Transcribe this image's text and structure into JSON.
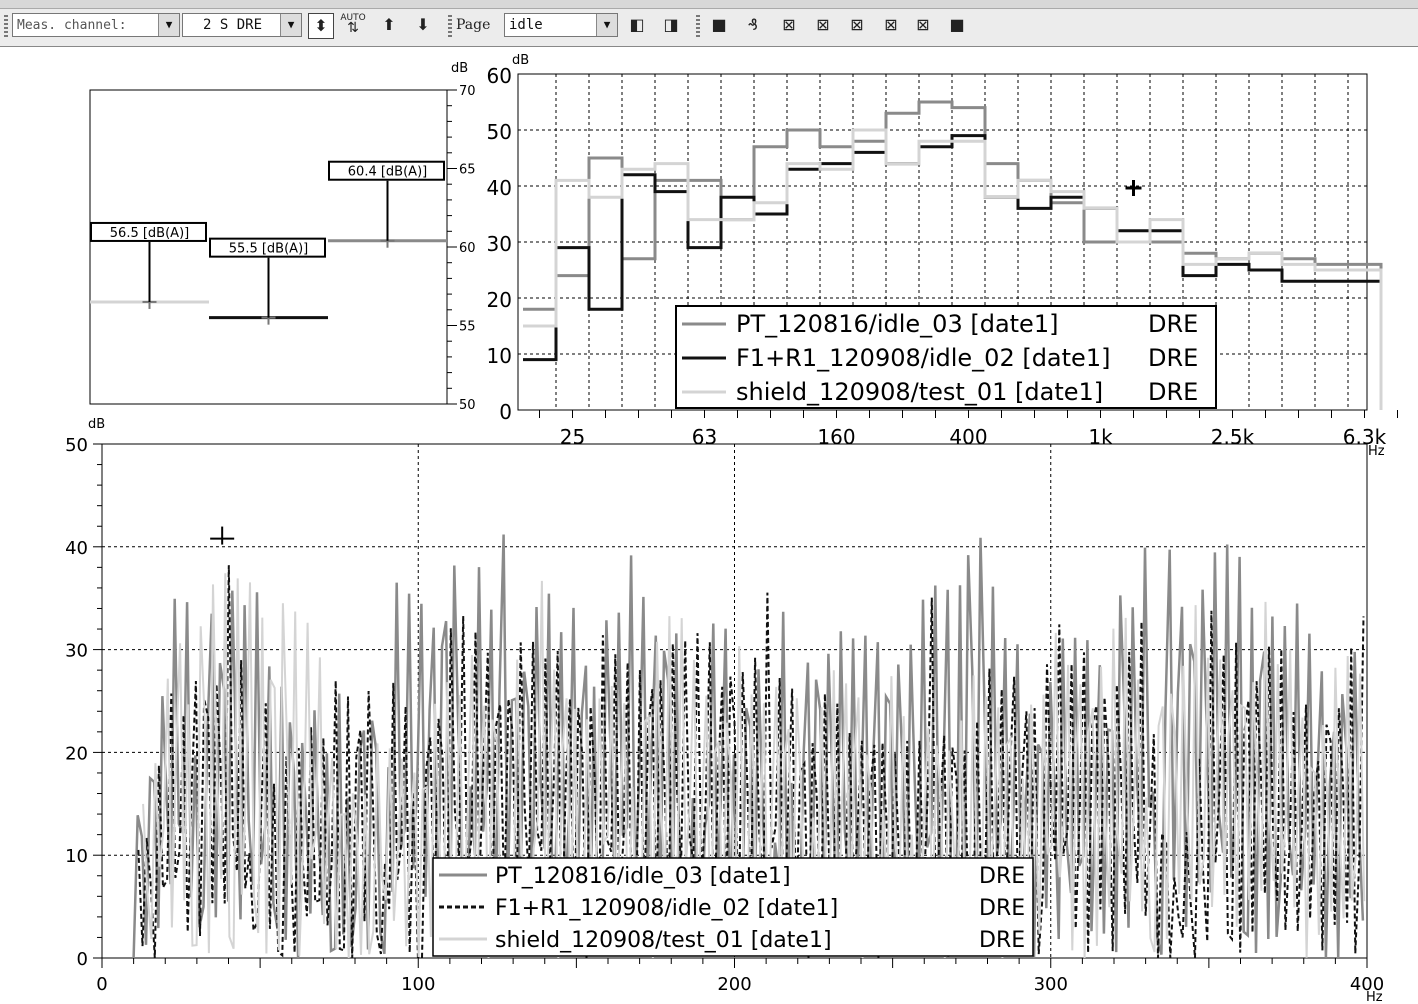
{
  "toolbar": {
    "meas_channel_label": "Meas. channel:",
    "channel_value": "2  S DRE",
    "page_label": "Page",
    "page_value": "idle",
    "auto_label": "AUTO"
  },
  "chart_data": [
    {
      "type": "bar",
      "id": "overall",
      "ylabel": "dB",
      "ylim": [
        50,
        70
      ],
      "yticks": [
        50,
        55,
        60,
        65,
        70
      ],
      "bars": [
        {
          "value": 56.5,
          "label": "56.5  [dB(A)]",
          "color": "#d4d4d4"
        },
        {
          "value": 55.5,
          "label": "55.5  [dB(A)]",
          "color": "#111111"
        },
        {
          "value": 60.4,
          "label": "60.4  [dB(A)]",
          "color": "#8a8a8a"
        }
      ]
    },
    {
      "type": "line",
      "id": "third_octave",
      "ylabel": "dB",
      "ylim": [
        0,
        60
      ],
      "yticks": [
        0,
        10,
        20,
        30,
        40,
        50,
        60
      ],
      "x_tick_labels": [
        "25",
        "63",
        "160",
        "400",
        "1k",
        "2.5k",
        "6.3k"
      ],
      "x_unit": "Hz",
      "bands": [
        "20",
        "25",
        "31.5",
        "40",
        "50",
        "63",
        "80",
        "100",
        "125",
        "160",
        "200",
        "250",
        "315",
        "400",
        "500",
        "630",
        "800",
        "1k",
        "1.25k",
        "1.6k",
        "2k",
        "2.5k",
        "3.15k",
        "4k",
        "5k",
        "6.3k"
      ],
      "grid": true,
      "legend_position": "lower-right",
      "series": [
        {
          "name": "PT_120816/idle_03 [date1]",
          "channel": "DRE",
          "color": "#8a8a8a",
          "values": [
            18,
            24,
            45,
            27,
            41,
            41,
            34,
            47,
            50,
            47,
            48,
            53,
            55,
            54,
            44,
            41,
            37,
            30,
            30,
            30,
            28,
            27,
            28,
            27,
            26,
            26
          ]
        },
        {
          "name": "F1+R1_120908/idle_02 [date1]",
          "channel": "DRE",
          "color": "#111111",
          "values": [
            9,
            29,
            18,
            42,
            39,
            29,
            38,
            35,
            43,
            44,
            46,
            44,
            47,
            49,
            38,
            36,
            38,
            36,
            32,
            32,
            24,
            26,
            25,
            23,
            23,
            23
          ]
        },
        {
          "name": "shield_120908/test_01 [date1]",
          "channel": "DRE",
          "color": "#d4d4d4",
          "values": [
            15,
            41,
            38,
            43,
            44,
            34,
            34,
            37,
            44,
            43,
            50,
            44,
            48,
            48,
            38,
            41,
            39,
            36,
            30,
            34,
            26,
            27,
            28,
            26,
            25,
            25
          ]
        }
      ],
      "cursor": {
        "band": "1.25k",
        "value": 40
      }
    },
    {
      "type": "line",
      "id": "narrowband",
      "ylabel": "dB",
      "ylim": [
        0,
        50
      ],
      "yticks": [
        0,
        10,
        20,
        30,
        40,
        50
      ],
      "xlim": [
        0,
        400
      ],
      "xticks": [
        0,
        100,
        200,
        300,
        400
      ],
      "x_unit": "Hz",
      "grid": true,
      "legend_position": "bottom-center",
      "series": [
        {
          "name": "PT_120816/idle_03  [date1]",
          "channel": "DRE",
          "color": "#8a8a8a",
          "dash": "",
          "envelope": [
            [
              10,
              18
            ],
            [
              25,
              38
            ],
            [
              45,
              40
            ],
            [
              70,
              24
            ],
            [
              95,
              40
            ],
            [
              110,
              45
            ],
            [
              130,
              38
            ],
            [
              150,
              38
            ],
            [
              170,
              40
            ],
            [
              200,
              35
            ],
            [
              230,
              34
            ],
            [
              260,
              36
            ],
            [
              275,
              49
            ],
            [
              290,
              32
            ],
            [
              320,
              34
            ],
            [
              335,
              45
            ],
            [
              350,
              42
            ],
            [
              370,
              40
            ],
            [
              390,
              30
            ],
            [
              400,
              33
            ]
          ],
          "peaks": [
            [
              36,
              44
            ],
            [
              110,
              43
            ],
            [
              127,
              47
            ],
            [
              190,
              42
            ],
            [
              275,
              49
            ],
            [
              323,
              47
            ],
            [
              335,
              46
            ],
            [
              355,
              44
            ]
          ]
        },
        {
          "name": "F1+R1_120908/idle_02  [date1]",
          "channel": "DRE",
          "color": "#111111",
          "dash": "5,3",
          "envelope": [
            [
              10,
              14
            ],
            [
              25,
              30
            ],
            [
              40,
              38
            ],
            [
              60,
              22
            ],
            [
              80,
              32
            ],
            [
              100,
              28
            ],
            [
              120,
              36
            ],
            [
              150,
              33
            ],
            [
              180,
              33
            ],
            [
              200,
              34
            ],
            [
              230,
              28
            ],
            [
              260,
              25
            ],
            [
              280,
              30
            ],
            [
              300,
              33
            ],
            [
              330,
              34
            ],
            [
              340,
              12
            ],
            [
              360,
              36
            ],
            [
              380,
              28
            ],
            [
              400,
              36
            ]
          ],
          "peaks": [
            [
              39,
              42
            ],
            [
              48,
              39
            ],
            [
              87,
              37
            ],
            [
              112,
              39
            ],
            [
              150,
              36
            ],
            [
              211,
              39
            ],
            [
              262,
              38
            ],
            [
              353,
              39
            ]
          ]
        },
        {
          "name": "shield_120908/test_01  [date1]",
          "channel": "DRE",
          "color": "#d4d4d4",
          "dash": "",
          "envelope": [
            [
              10,
              12
            ],
            [
              25,
              40
            ],
            [
              40,
              42
            ],
            [
              60,
              38
            ],
            [
              80,
              22
            ],
            [
              100,
              26
            ],
            [
              130,
              35
            ],
            [
              150,
              30
            ],
            [
              180,
              35
            ],
            [
              210,
              30
            ],
            [
              240,
              30
            ],
            [
              270,
              27
            ],
            [
              300,
              32
            ],
            [
              330,
              34
            ],
            [
              360,
              36
            ],
            [
              390,
              30
            ],
            [
              400,
              34
            ]
          ],
          "peaks": [
            [
              27,
              41
            ],
            [
              47,
              39
            ],
            [
              55,
              42
            ],
            [
              137,
              43
            ],
            [
              148,
              35
            ],
            [
              200,
              34
            ],
            [
              320,
              35
            ],
            [
              367,
              38
            ]
          ]
        }
      ],
      "cursor": {
        "x": 38,
        "value": 40.8
      }
    }
  ]
}
